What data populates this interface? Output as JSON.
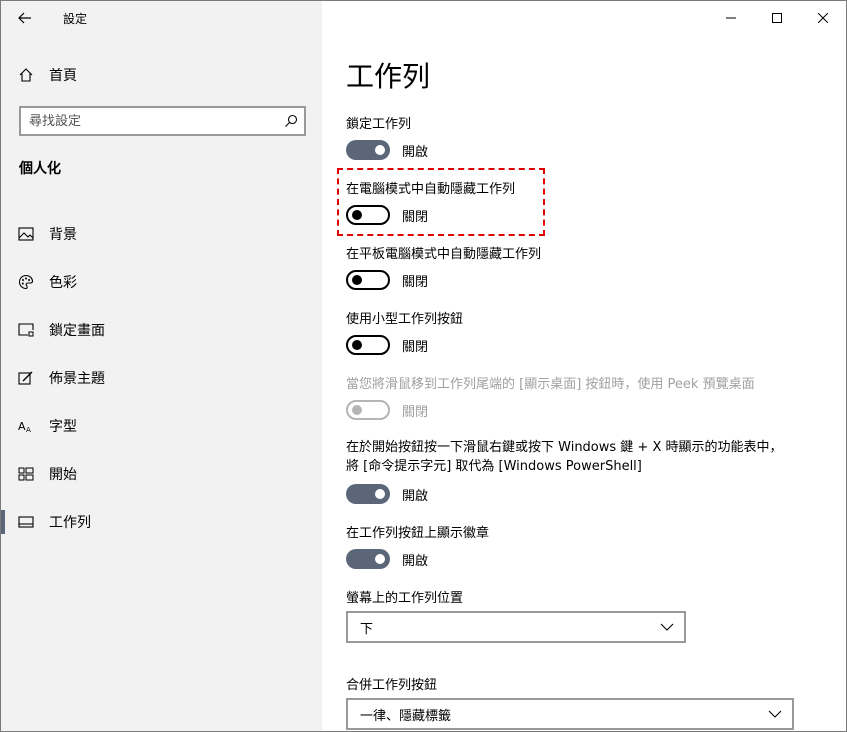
{
  "window": {
    "app_title": "設定",
    "back_icon": "back-arrow-icon",
    "minimize_icon": "minimize-icon",
    "maximize_icon": "maximize-icon",
    "close_icon": "close-icon"
  },
  "sidebar": {
    "home_label": "首頁",
    "search_placeholder": "尋找設定",
    "section_title": "個人化",
    "items": [
      {
        "label": "背景",
        "icon": "picture-icon"
      },
      {
        "label": "色彩",
        "icon": "palette-icon"
      },
      {
        "label": "鎖定畫面",
        "icon": "lock-screen-icon"
      },
      {
        "label": "佈景主題",
        "icon": "theme-brush-icon"
      },
      {
        "label": "字型",
        "icon": "font-icon"
      },
      {
        "label": "開始",
        "icon": "start-grid-icon"
      },
      {
        "label": "工作列",
        "icon": "taskbar-icon",
        "active": true
      }
    ]
  },
  "main": {
    "title": "工作列",
    "settings": [
      {
        "label": "鎖定工作列",
        "state": "開啟",
        "on": true
      },
      {
        "label": "在電腦模式中自動隱藏工作列",
        "state": "關閉",
        "on": false,
        "highlighted": true
      },
      {
        "label": "在平板電腦模式中自動隱藏工作列",
        "state": "關閉",
        "on": false
      },
      {
        "label": "使用小型工作列按鈕",
        "state": "關閉",
        "on": false
      },
      {
        "label": "當您將滑鼠移到工作列尾端的 [顯示桌面] 按鈕時，使用 Peek 預覽桌面",
        "state": "關閉",
        "on": false,
        "disabled": true
      },
      {
        "label": "在於開始按鈕按一下滑鼠右鍵或按下 Windows 鍵 + X 時顯示的功能表中，將 [命令提示字元] 取代為 [Windows PowerShell]",
        "state": "開啟",
        "on": true
      },
      {
        "label": "在工作列按鈕上顯示徽章",
        "state": "開啟",
        "on": true
      }
    ],
    "position": {
      "label": "螢幕上的工作列位置",
      "value": "下"
    },
    "combine": {
      "label": "合併工作列按鈕",
      "value": "一律、隱藏標籤"
    }
  },
  "colors": {
    "accent": "#5b6778",
    "highlight": "#e00000",
    "sidebar_bg": "#f2f2f2"
  }
}
